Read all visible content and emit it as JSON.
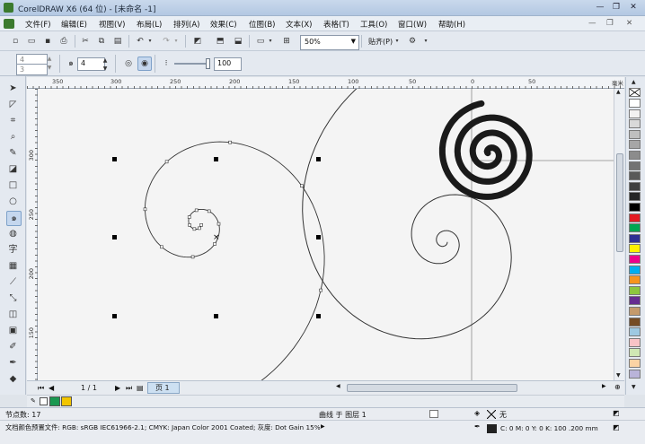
{
  "window": {
    "title": "CorelDRAW X6 (64 位) - [未命名 -1]"
  },
  "menu": [
    "文件(F)",
    "编辑(E)",
    "视图(V)",
    "布局(L)",
    "排列(A)",
    "效果(C)",
    "位图(B)",
    "文本(X)",
    "表格(T)",
    "工具(O)",
    "窗口(W)",
    "帮助(H)"
  ],
  "toolbar": {
    "zoom": "50%",
    "snap_label": "贴齐(P)"
  },
  "property_bar": {
    "field_a": "4",
    "field_b": "3",
    "revolutions": "4",
    "expansion": "100"
  },
  "ruler": {
    "h_ticks": [
      "350",
      "300",
      "250",
      "200",
      "150",
      "100",
      "50",
      "0",
      "50",
      "毫米"
    ],
    "v_ticks": [
      "300",
      "250",
      "200",
      "150"
    ]
  },
  "pages": {
    "counter": "1 / 1",
    "tab": "页 1"
  },
  "status": {
    "nodes": "节点数: 17",
    "object": "曲线 于 图层 1",
    "fill": "无",
    "profile": "文档颜色预置文件: RGB: sRGB IEC61966-2.1; CMYK: Japan Color 2001 Coated; 灰度: Dot Gain 15%",
    "outline": "C: 0 M: 0 Y: 0 K: 100  .200 mm"
  },
  "palette_colors": [
    "#ffffff",
    "#f2f2f2",
    "#d9d9d9",
    "#bfbfbf",
    "#a6a6a6",
    "#8c8c8c",
    "#737373",
    "#595959",
    "#404040",
    "#262626",
    "#000000",
    "#e31b23",
    "#00a651",
    "#2e3192",
    "#fff200",
    "#ec008c",
    "#00aeef",
    "#f7941d",
    "#8dc63f",
    "#662d91",
    "#c49a6c",
    "#754c24",
    "#9ec9e2",
    "#f9c3c6",
    "#cfe8b4",
    "#fbd3a4",
    "#b9b3d9"
  ],
  "docpal_colors": [
    "#1a9850",
    "#f2c500"
  ]
}
